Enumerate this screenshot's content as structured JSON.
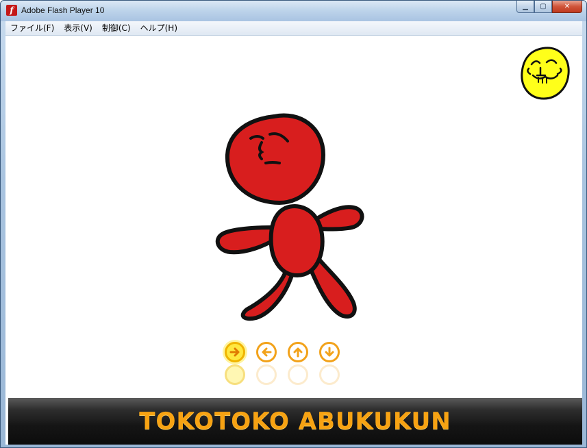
{
  "window": {
    "title": "Adobe Flash Player 10",
    "icon": "flash-icon",
    "icon_letter": "f"
  },
  "controls": {
    "minimize_glyph": "▁",
    "maximize_glyph": "▢",
    "close_glyph": "✕"
  },
  "menu": {
    "items": [
      "ファイル(F)",
      "表示(V)",
      "制御(C)",
      "ヘルプ(H)"
    ]
  },
  "content": {
    "arrow_buttons": [
      {
        "icon": "arrow-right-icon",
        "state": "active"
      },
      {
        "icon": "arrow-left-icon",
        "state": "normal"
      },
      {
        "icon": "arrow-up-icon",
        "state": "normal"
      },
      {
        "icon": "arrow-down-icon",
        "state": "normal"
      }
    ],
    "banner_text": "TOKOTOKO ABUKUKUN"
  },
  "colors": {
    "character_red": "#d81e1e",
    "outline": "#111111",
    "face_yellow": "#ffff1a",
    "accent_orange": "#f7a313"
  }
}
